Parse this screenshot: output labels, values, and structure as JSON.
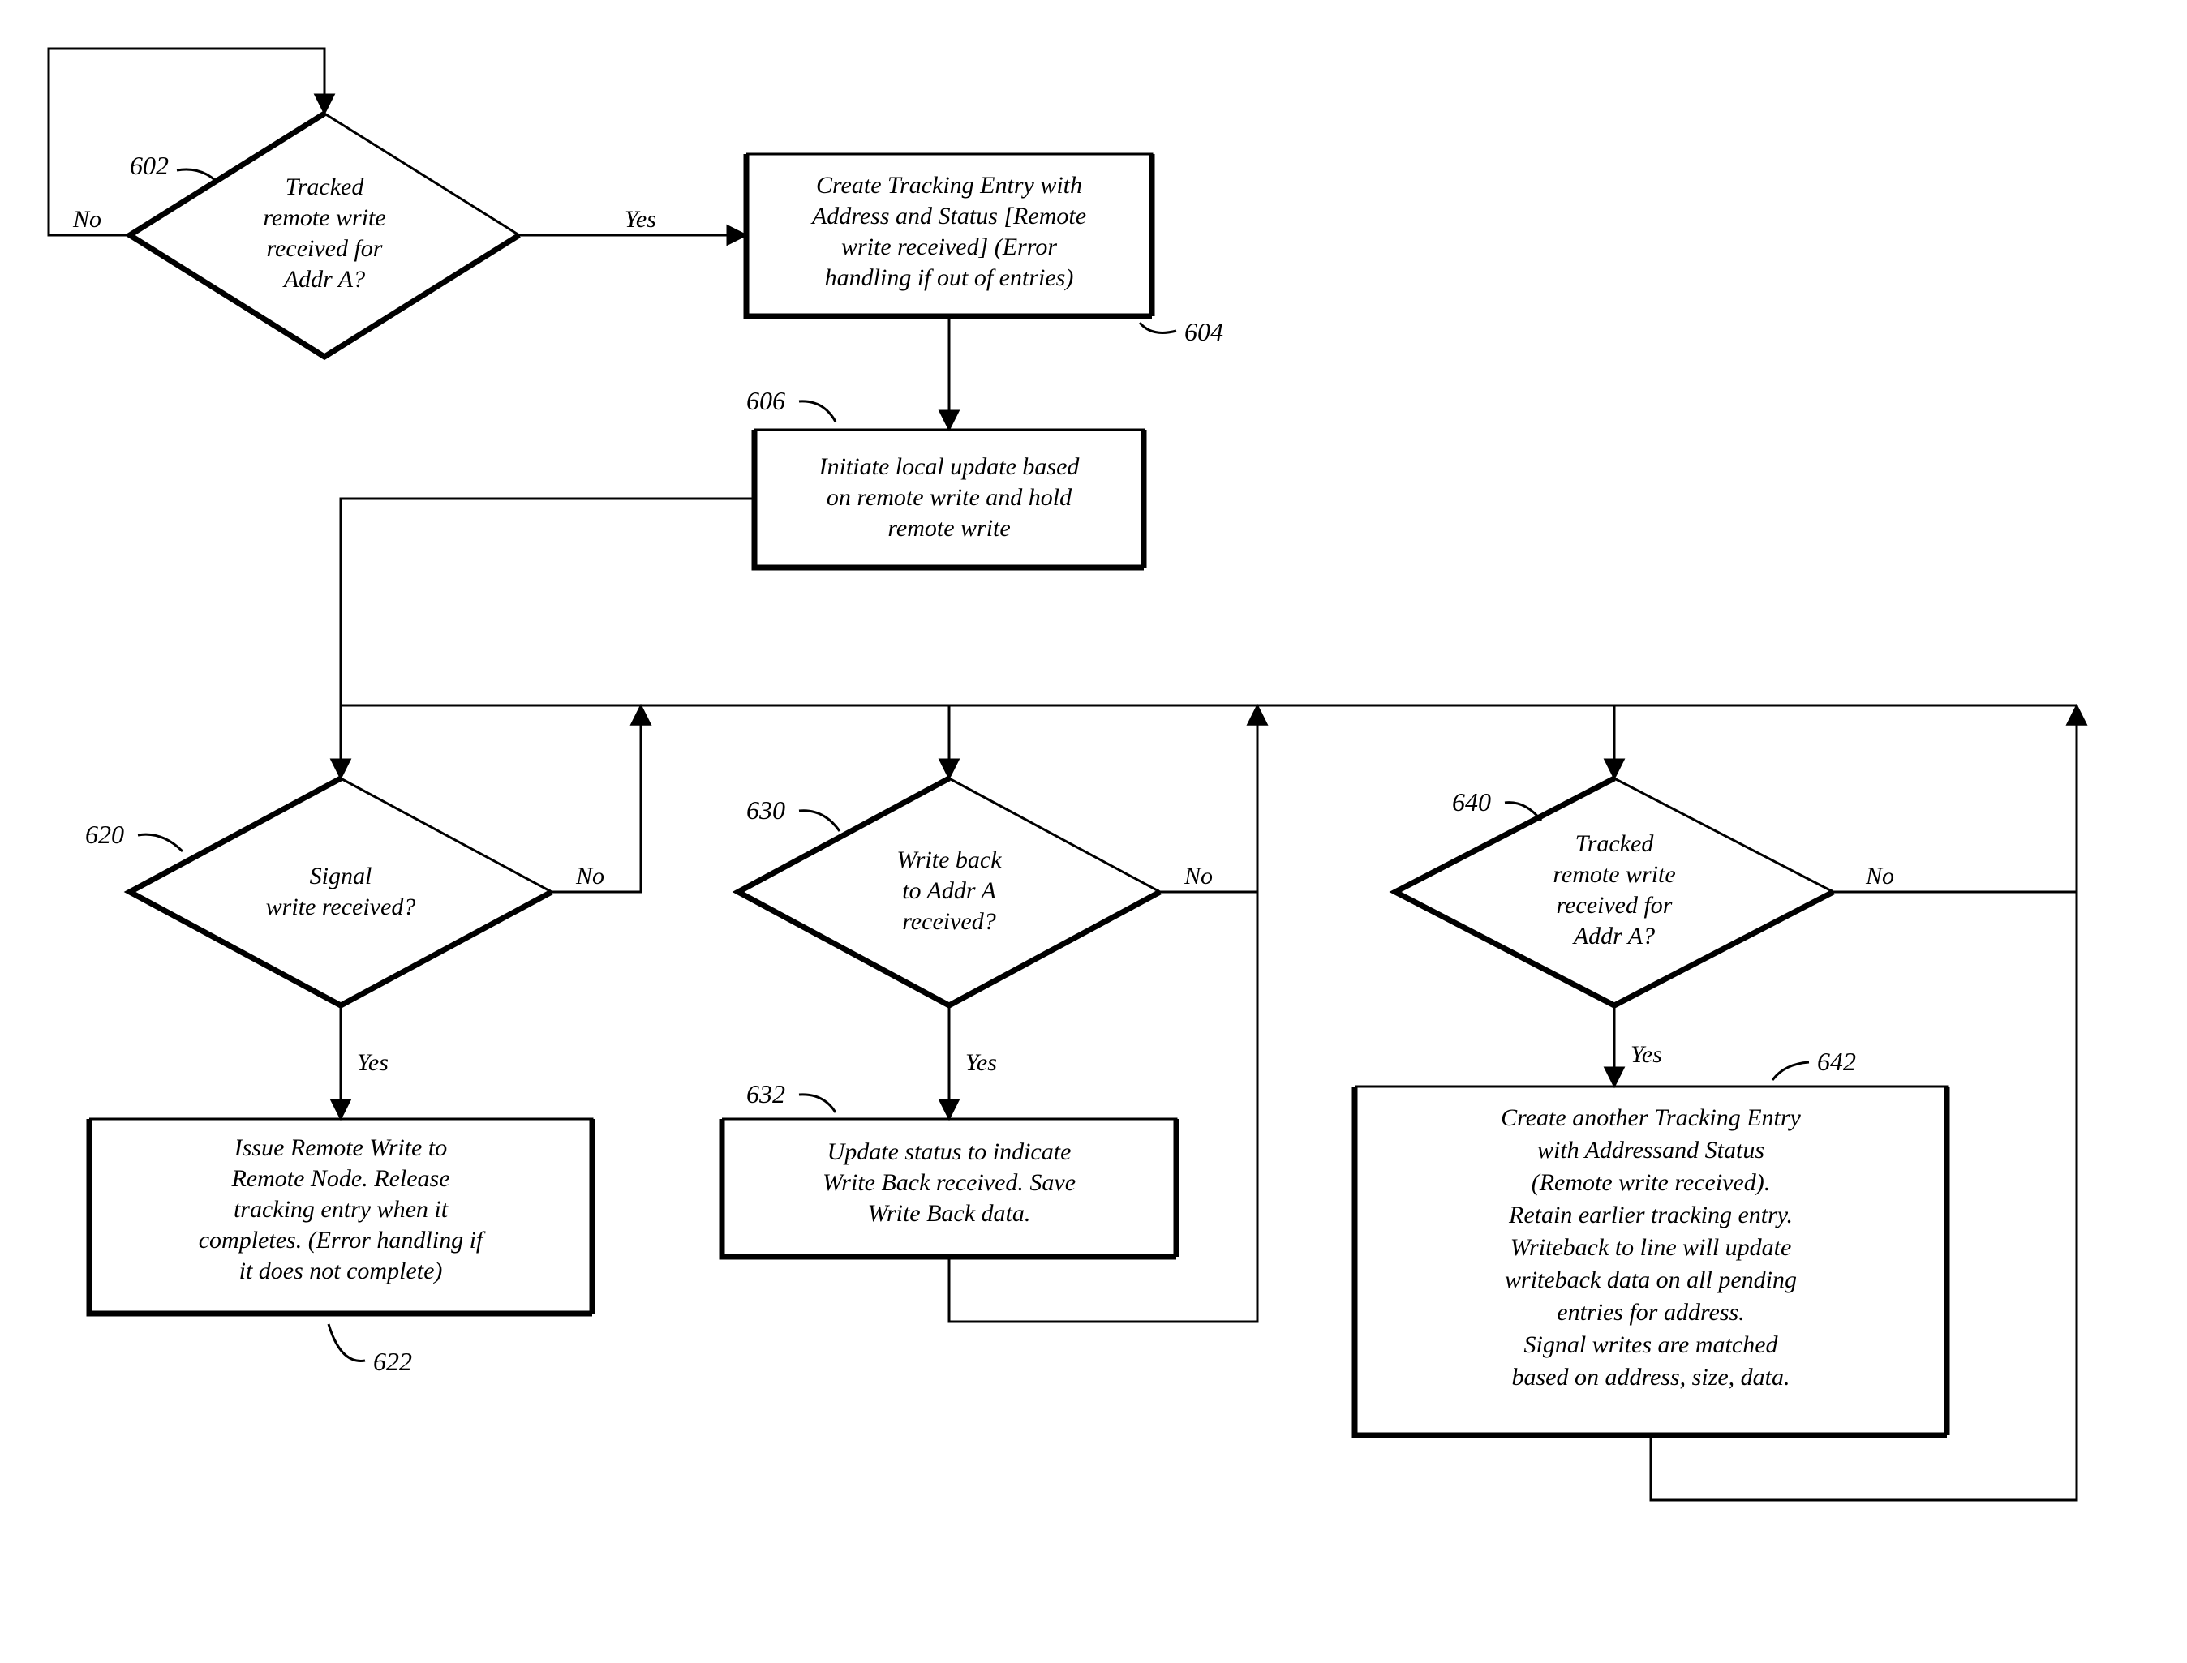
{
  "refs": {
    "r602": "602",
    "r604": "604",
    "r606": "606",
    "r620": "620",
    "r622": "622",
    "r630": "630",
    "r632": "632",
    "r640": "640",
    "r642": "642"
  },
  "labels": {
    "yes": "Yes",
    "no": "No"
  },
  "d602": {
    "l1": "Tracked",
    "l2": "remote write",
    "l3": "received for",
    "l4": "Addr A?"
  },
  "b604": {
    "l1": "Create Tracking Entry with",
    "l2": "Address and Status [Remote",
    "l3": "write received] (Error",
    "l4": "handling if out of entries)"
  },
  "b606": {
    "l1": "Initiate local update based",
    "l2": "on remote write and hold",
    "l3": "remote write"
  },
  "d620": {
    "l1": "Signal",
    "l2": "write received?"
  },
  "b622": {
    "l1": "Issue Remote Write to",
    "l2": "Remote Node. Release",
    "l3": "tracking entry when it",
    "l4": "completes. (Error handling if",
    "l5": "it does not complete)"
  },
  "d630": {
    "l1": "Write back",
    "l2": "to Addr A",
    "l3": "received?"
  },
  "b632": {
    "l1": "Update status to indicate",
    "l2": "Write Back received. Save",
    "l3": "Write Back data."
  },
  "d640": {
    "l1": "Tracked",
    "l2": "remote write",
    "l3": "received for",
    "l4": "Addr A?"
  },
  "b642": {
    "l1": "Create another Tracking Entry",
    "l2": "with Addressand Status",
    "l3": "(Remote write received).",
    "l4": "Retain earlier tracking entry.",
    "l5": "Writeback to line will update",
    "l6": "writeback data on all pending",
    "l7": "entries for address.",
    "l8": "Signal writes are matched",
    "l9": "based on address, size, data."
  }
}
